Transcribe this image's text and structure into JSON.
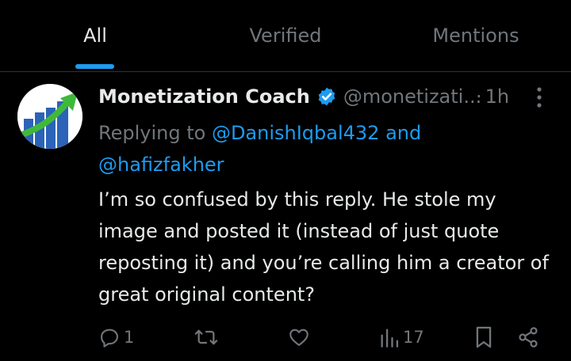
{
  "tabs": [
    {
      "label": "All",
      "active": true
    },
    {
      "label": "Verified",
      "active": false
    },
    {
      "label": "Mentions",
      "active": false
    }
  ],
  "post": {
    "author_name": "Monetization Coach",
    "handle": "@monetizati...",
    "separator": "·",
    "time": "1h",
    "replying_prefix": "Replying to ",
    "replying_user1": "@DanishIqbal432",
    "replying_and": " and",
    "replying_user2": "@hafizfakher",
    "text": "I’m so confused by this reply. He stole my image and posted it (instead of just quote reposting it) and you’re calling him a creator of great original content?"
  },
  "actions": {
    "reply_count": "1",
    "repost_count": "",
    "like_count": "",
    "views_count": "17"
  },
  "icons": [
    "chart-growth-avatar",
    "verified-badge-icon",
    "more-icon",
    "reply-icon",
    "repost-icon",
    "like-icon",
    "views-icon",
    "bookmark-icon",
    "share-icon"
  ],
  "colors": {
    "background": "#000000",
    "text": "#e7e9ea",
    "muted": "#71767b",
    "accent": "#1d9bf0",
    "divider": "#2f3336"
  }
}
